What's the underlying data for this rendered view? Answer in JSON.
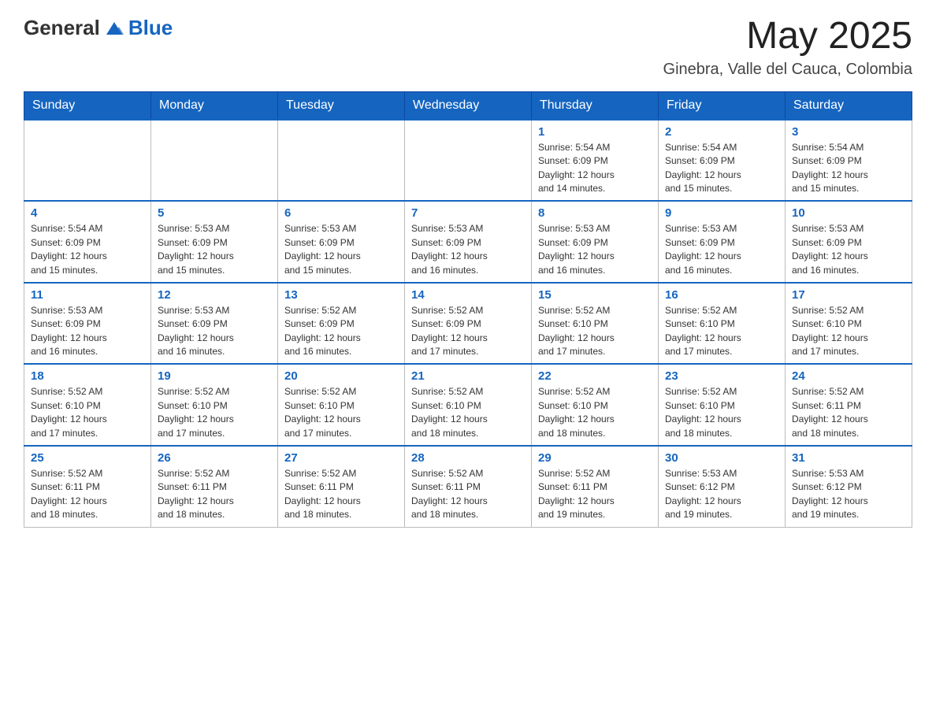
{
  "header": {
    "logo_general": "General",
    "logo_blue": "Blue",
    "month_title": "May 2025",
    "subtitle": "Ginebra, Valle del Cauca, Colombia"
  },
  "weekdays": [
    "Sunday",
    "Monday",
    "Tuesday",
    "Wednesday",
    "Thursday",
    "Friday",
    "Saturday"
  ],
  "weeks": [
    [
      {
        "day": "",
        "info": ""
      },
      {
        "day": "",
        "info": ""
      },
      {
        "day": "",
        "info": ""
      },
      {
        "day": "",
        "info": ""
      },
      {
        "day": "1",
        "info": "Sunrise: 5:54 AM\nSunset: 6:09 PM\nDaylight: 12 hours\nand 14 minutes."
      },
      {
        "day": "2",
        "info": "Sunrise: 5:54 AM\nSunset: 6:09 PM\nDaylight: 12 hours\nand 15 minutes."
      },
      {
        "day": "3",
        "info": "Sunrise: 5:54 AM\nSunset: 6:09 PM\nDaylight: 12 hours\nand 15 minutes."
      }
    ],
    [
      {
        "day": "4",
        "info": "Sunrise: 5:54 AM\nSunset: 6:09 PM\nDaylight: 12 hours\nand 15 minutes."
      },
      {
        "day": "5",
        "info": "Sunrise: 5:53 AM\nSunset: 6:09 PM\nDaylight: 12 hours\nand 15 minutes."
      },
      {
        "day": "6",
        "info": "Sunrise: 5:53 AM\nSunset: 6:09 PM\nDaylight: 12 hours\nand 15 minutes."
      },
      {
        "day": "7",
        "info": "Sunrise: 5:53 AM\nSunset: 6:09 PM\nDaylight: 12 hours\nand 16 minutes."
      },
      {
        "day": "8",
        "info": "Sunrise: 5:53 AM\nSunset: 6:09 PM\nDaylight: 12 hours\nand 16 minutes."
      },
      {
        "day": "9",
        "info": "Sunrise: 5:53 AM\nSunset: 6:09 PM\nDaylight: 12 hours\nand 16 minutes."
      },
      {
        "day": "10",
        "info": "Sunrise: 5:53 AM\nSunset: 6:09 PM\nDaylight: 12 hours\nand 16 minutes."
      }
    ],
    [
      {
        "day": "11",
        "info": "Sunrise: 5:53 AM\nSunset: 6:09 PM\nDaylight: 12 hours\nand 16 minutes."
      },
      {
        "day": "12",
        "info": "Sunrise: 5:53 AM\nSunset: 6:09 PM\nDaylight: 12 hours\nand 16 minutes."
      },
      {
        "day": "13",
        "info": "Sunrise: 5:52 AM\nSunset: 6:09 PM\nDaylight: 12 hours\nand 16 minutes."
      },
      {
        "day": "14",
        "info": "Sunrise: 5:52 AM\nSunset: 6:09 PM\nDaylight: 12 hours\nand 17 minutes."
      },
      {
        "day": "15",
        "info": "Sunrise: 5:52 AM\nSunset: 6:10 PM\nDaylight: 12 hours\nand 17 minutes."
      },
      {
        "day": "16",
        "info": "Sunrise: 5:52 AM\nSunset: 6:10 PM\nDaylight: 12 hours\nand 17 minutes."
      },
      {
        "day": "17",
        "info": "Sunrise: 5:52 AM\nSunset: 6:10 PM\nDaylight: 12 hours\nand 17 minutes."
      }
    ],
    [
      {
        "day": "18",
        "info": "Sunrise: 5:52 AM\nSunset: 6:10 PM\nDaylight: 12 hours\nand 17 minutes."
      },
      {
        "day": "19",
        "info": "Sunrise: 5:52 AM\nSunset: 6:10 PM\nDaylight: 12 hours\nand 17 minutes."
      },
      {
        "day": "20",
        "info": "Sunrise: 5:52 AM\nSunset: 6:10 PM\nDaylight: 12 hours\nand 17 minutes."
      },
      {
        "day": "21",
        "info": "Sunrise: 5:52 AM\nSunset: 6:10 PM\nDaylight: 12 hours\nand 18 minutes."
      },
      {
        "day": "22",
        "info": "Sunrise: 5:52 AM\nSunset: 6:10 PM\nDaylight: 12 hours\nand 18 minutes."
      },
      {
        "day": "23",
        "info": "Sunrise: 5:52 AM\nSunset: 6:10 PM\nDaylight: 12 hours\nand 18 minutes."
      },
      {
        "day": "24",
        "info": "Sunrise: 5:52 AM\nSunset: 6:11 PM\nDaylight: 12 hours\nand 18 minutes."
      }
    ],
    [
      {
        "day": "25",
        "info": "Sunrise: 5:52 AM\nSunset: 6:11 PM\nDaylight: 12 hours\nand 18 minutes."
      },
      {
        "day": "26",
        "info": "Sunrise: 5:52 AM\nSunset: 6:11 PM\nDaylight: 12 hours\nand 18 minutes."
      },
      {
        "day": "27",
        "info": "Sunrise: 5:52 AM\nSunset: 6:11 PM\nDaylight: 12 hours\nand 18 minutes."
      },
      {
        "day": "28",
        "info": "Sunrise: 5:52 AM\nSunset: 6:11 PM\nDaylight: 12 hours\nand 18 minutes."
      },
      {
        "day": "29",
        "info": "Sunrise: 5:52 AM\nSunset: 6:11 PM\nDaylight: 12 hours\nand 19 minutes."
      },
      {
        "day": "30",
        "info": "Sunrise: 5:53 AM\nSunset: 6:12 PM\nDaylight: 12 hours\nand 19 minutes."
      },
      {
        "day": "31",
        "info": "Sunrise: 5:53 AM\nSunset: 6:12 PM\nDaylight: 12 hours\nand 19 minutes."
      }
    ]
  ]
}
